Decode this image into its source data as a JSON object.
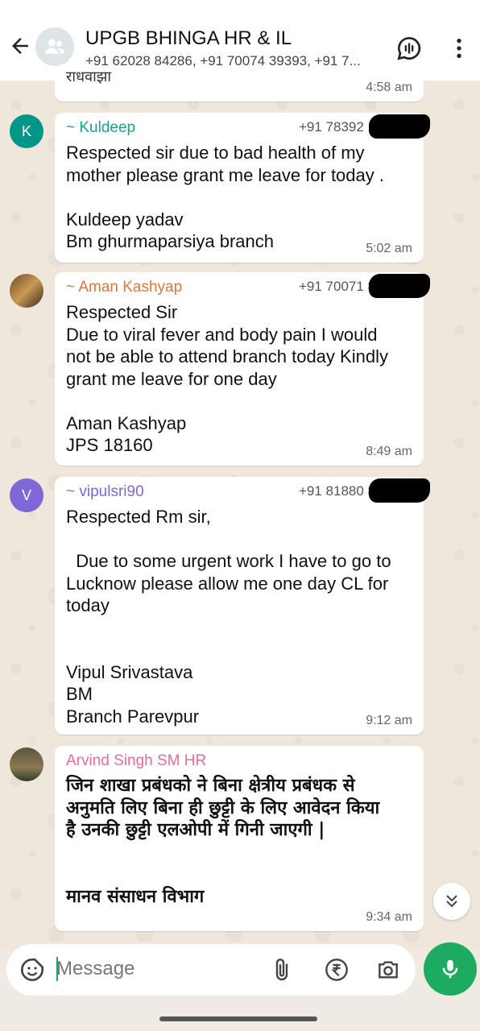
{
  "header": {
    "title": "UPGB BHINGA HR & IL",
    "subtitle": "+91 62028 84286, +91 70074 39393, +91 7..."
  },
  "messages": [
    {
      "partial_text": "राधवाझा",
      "time": "4:58 am"
    },
    {
      "avatar_letter": "K",
      "avatar_color": "#009688",
      "sender": "~ Kuldeep",
      "sender_color": "#1aa38a",
      "phone": "+91 78392 1",
      "text": "Respected sir due to bad health of my\nmother please grant me leave for today .\n\nKuldeep yadav\nBm ghurmaparsiya branch",
      "time": "5:02 am"
    },
    {
      "sender": "~ Aman Kashyap",
      "sender_color": "#d9773e",
      "phone": "+91 70071 8",
      "text": "Respected Sir\nDue to viral fever and body pain I would\nnot be able to attend branch today Kindly\ngrant me leave for one day\n\nAman Kashyap\nJPS 18160",
      "time": "8:49 am"
    },
    {
      "avatar_letter": "V",
      "avatar_color": "#7e67d6",
      "sender": "~ vipulsri90",
      "sender_color": "#7e67d6",
      "phone": "+91 81880 8",
      "text": "Respected Rm sir,\n\n  Due to some urgent work I have to go to\nLucknow please allow me one day CL for\ntoday\n\n\nVipul Srivastava\nBM\nBranch Parevpur",
      "time": "9:12 am"
    },
    {
      "sender": "Arvind Singh SM HR",
      "sender_color": "#e86b9b",
      "text": "जिन शाखा प्रबंधको ने बिना क्षेत्रीय प्रबंधक से\nअनुमति लिए बिना ही छुट्टी के लिए आवेदन किया\nहै उनकी छुट्टी एलओपी में गिनी जाएगी |\n\n\nमानव संसाधन विभाग",
      "time": "9:34 am"
    }
  ],
  "composer": {
    "placeholder": "Message"
  },
  "icons": [
    "back-arrow-icon",
    "group-icon",
    "voice-chat-icon",
    "more-icon",
    "sticker-icon",
    "attach-icon",
    "rupee-icon",
    "camera-icon",
    "mic-icon",
    "double-chevron-down-icon"
  ],
  "colors": {
    "accent": "#1daa61",
    "bubble": "#ffffff"
  }
}
